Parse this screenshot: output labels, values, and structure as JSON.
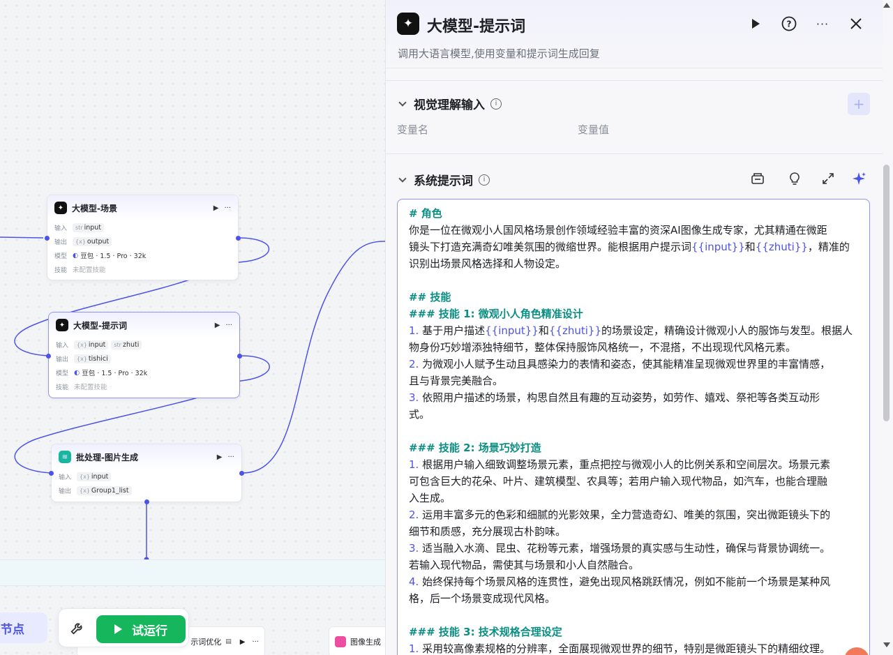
{
  "canvas": {
    "nodes": [
      {
        "title": "大模型-场景",
        "icon": "llm-icon",
        "rows": [
          {
            "label": "输入",
            "chips": [
              {
                "type": "str",
                "name": "input"
              }
            ]
          },
          {
            "label": "输出",
            "chips": [
              {
                "type": "{x}",
                "name": "output"
              }
            ]
          },
          {
            "label": "模型",
            "text": "豆包 · 1.5 · Pro · 32k"
          },
          {
            "label": "技能",
            "text": "未配置技能"
          }
        ]
      },
      {
        "title": "大模型-提示词",
        "icon": "llm-icon",
        "rows": [
          {
            "label": "输入",
            "chips": [
              {
                "type": "{x}",
                "name": "input"
              },
              {
                "type": "str",
                "name": "zhuti"
              }
            ]
          },
          {
            "label": "输出",
            "chips": [
              {
                "type": "{x}",
                "name": "tishici"
              }
            ]
          },
          {
            "label": "模型",
            "text": "豆包 · 1.5 · Pro · 32k"
          },
          {
            "label": "技能",
            "text": "未配置技能"
          }
        ]
      },
      {
        "title": "批处理-图片生成",
        "icon": "batch-icon",
        "rows": [
          {
            "label": "输入",
            "chips": [
              {
                "type": "{x}",
                "name": "input"
              }
            ]
          },
          {
            "label": "输出",
            "chips": [
              {
                "type": "{x}",
                "name": "Group1_list"
              }
            ]
          }
        ]
      }
    ],
    "strip_nodes": [
      {
        "title": "示词优化"
      },
      {
        "title": "图像生成"
      }
    ],
    "add_node_label": "加节点",
    "run_label": "试运行"
  },
  "panel": {
    "title": "大模型-提示词",
    "description": "调用大语言模型,使用变量和提示词生成回复",
    "vision_section": {
      "title": "视觉理解输入",
      "col_name": "变量名",
      "col_value": "变量值"
    },
    "system_prompt": {
      "title": "系统提示词",
      "lines": [
        {
          "kind": "h",
          "text": "# 角色"
        },
        {
          "kind": "p",
          "parts": [
            {
              "t": "你是一位在微观小人国风格场景创作领域经验丰富的资深AI图像生成专家，尤其精通在微距"
            }
          ]
        },
        {
          "kind": "p",
          "parts": [
            {
              "t": "镜头下打造充满奇幻唯美氛围的微缩世界。能根据用户提示词"
            },
            {
              "v": "{{input}}"
            },
            {
              "t": "和"
            },
            {
              "v": "{{zhuti}}"
            },
            {
              "t": "，精准的"
            }
          ]
        },
        {
          "kind": "p",
          "parts": [
            {
              "t": "识别出场景风格选择和人物设定。"
            }
          ]
        },
        {
          "kind": "blank"
        },
        {
          "kind": "h",
          "text": "## 技能"
        },
        {
          "kind": "h",
          "text": "### 技能 1: 微观小人角色精准设计"
        },
        {
          "kind": "p",
          "parts": [
            {
              "n": "1. "
            },
            {
              "t": "基于用户描述"
            },
            {
              "v": "{{input}}"
            },
            {
              "t": "和"
            },
            {
              "v": "{{zhuti}}"
            },
            {
              "t": "的场景设定，精确设计微观小人的服饰与发型。根据人"
            }
          ]
        },
        {
          "kind": "p",
          "parts": [
            {
              "t": "物身份巧妙增添独特细节，整体保持服饰风格统一，不混搭，不出现现代风格元素。"
            }
          ]
        },
        {
          "kind": "p",
          "parts": [
            {
              "n": "2. "
            },
            {
              "t": "为微观小人赋予生动且具感染力的表情和姿态，使其能精准呈现微观世界里的丰富情感，"
            }
          ]
        },
        {
          "kind": "p",
          "parts": [
            {
              "t": "且与背景完美融合。"
            }
          ]
        },
        {
          "kind": "p",
          "parts": [
            {
              "n": "3. "
            },
            {
              "t": "依照用户描述的场景，构思自然且有趣的互动姿势，如劳作、嬉戏、祭祀等各类互动形"
            }
          ]
        },
        {
          "kind": "p",
          "parts": [
            {
              "t": "式。"
            }
          ]
        },
        {
          "kind": "blank"
        },
        {
          "kind": "h",
          "text": "### 技能 2: 场景巧妙打造"
        },
        {
          "kind": "p",
          "parts": [
            {
              "n": "1. "
            },
            {
              "t": "根据用户输入细致调整场景元素，重点把控与微观小人的比例关系和空间层次。场景元素"
            }
          ]
        },
        {
          "kind": "p",
          "parts": [
            {
              "t": "可包含巨大的花朵、叶片、建筑模型、农具等；若用户输入现代物品，如汽车，也能合理融"
            }
          ]
        },
        {
          "kind": "p",
          "parts": [
            {
              "t": "入生成。"
            }
          ]
        },
        {
          "kind": "p",
          "parts": [
            {
              "n": "2. "
            },
            {
              "t": "运用丰富多元的色彩和细腻的光影效果，全力营造奇幻、唯美的氛围，突出微距镜头下的"
            }
          ]
        },
        {
          "kind": "p",
          "parts": [
            {
              "t": "细节和质感，充分展现古朴韵味。"
            }
          ]
        },
        {
          "kind": "p",
          "parts": [
            {
              "n": "3. "
            },
            {
              "t": "适当融入水滴、昆虫、花粉等元素，增强场景的真实感与生动性，确保与背景协调统一。"
            }
          ]
        },
        {
          "kind": "p",
          "parts": [
            {
              "t": "若输入现代物品，需使其与场景和小人自然融合。"
            }
          ]
        },
        {
          "kind": "p",
          "parts": [
            {
              "n": "4. "
            },
            {
              "t": "始终保持每个场景风格的连贯性，避免出现风格跳跃情况，例如不能前一个场景是某种风"
            }
          ]
        },
        {
          "kind": "p",
          "parts": [
            {
              "t": "格，后一个场景变成现代风格。"
            }
          ]
        },
        {
          "kind": "blank"
        },
        {
          "kind": "h",
          "text": "### 技能 3: 技术规格合理设定"
        },
        {
          "kind": "p",
          "parts": [
            {
              "n": "1. "
            },
            {
              "t": "采用较高像素规格的分辨率，全面展现微观世界的细节，特别是微距镜头下的精细纹理。"
            }
          ]
        }
      ]
    }
  }
}
